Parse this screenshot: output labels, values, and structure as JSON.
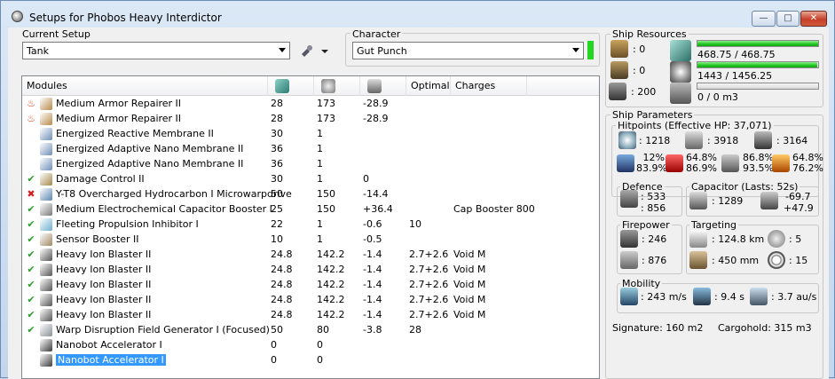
{
  "window": {
    "title": "Setups for Phobos Heavy Interdictor"
  },
  "current_setup": {
    "label": "Current Setup",
    "value": "Tank"
  },
  "character": {
    "label": "Character",
    "value": "Gut Punch"
  },
  "modules": {
    "columns": [
      "Modules",
      "Optimal",
      "Charges"
    ],
    "rows": [
      {
        "status": "overload",
        "name": "Medium Armor Repairer II",
        "cpu": "28",
        "pg": "173",
        "cap": "-28.9",
        "optimal": "",
        "charges": "",
        "icon": "armor-repairer-icon",
        "color": "#b88a4a"
      },
      {
        "status": "overload",
        "name": "Medium Armor Repairer II",
        "cpu": "28",
        "pg": "173",
        "cap": "-28.9",
        "optimal": "",
        "charges": "",
        "icon": "armor-repairer-icon",
        "color": "#b88a4a"
      },
      {
        "status": "passive",
        "name": "Energized Reactive Membrane II",
        "cpu": "30",
        "pg": "1",
        "cap": "",
        "optimal": "",
        "charges": "",
        "icon": "membrane-icon",
        "color": "#6f8fb8"
      },
      {
        "status": "passive",
        "name": "Energized Adaptive Nano Membrane II",
        "cpu": "36",
        "pg": "1",
        "cap": "",
        "optimal": "",
        "charges": "",
        "icon": "membrane-icon",
        "color": "#6f8fb8"
      },
      {
        "status": "passive",
        "name": "Energized Adaptive Nano Membrane II",
        "cpu": "36",
        "pg": "1",
        "cap": "",
        "optimal": "",
        "charges": "",
        "icon": "membrane-icon",
        "color": "#6f8fb8"
      },
      {
        "status": "active",
        "name": "Damage Control II",
        "cpu": "30",
        "pg": "1",
        "cap": "0",
        "optimal": "",
        "charges": "",
        "icon": "damage-control-icon",
        "color": "#a4884a"
      },
      {
        "status": "offline",
        "name": "Y-T8 Overcharged Hydrocarbon I Microwarpdrive",
        "cpu": "50",
        "pg": "150",
        "cap": "-14.4",
        "optimal": "",
        "charges": "",
        "icon": "microwarpdrive-icon",
        "color": "#5a86b0"
      },
      {
        "status": "active",
        "name": "Medium Electrochemical Capacitor Booster I",
        "cpu": "25",
        "pg": "150",
        "cap": "+36.4",
        "optimal": "",
        "charges": "Cap Booster 800",
        "icon": "capacitor-booster-icon",
        "color": "#7b7b7b"
      },
      {
        "status": "active",
        "name": "Fleeting Propulsion Inhibitor I",
        "cpu": "22",
        "pg": "1",
        "cap": "-0.6",
        "optimal": "10",
        "charges": "",
        "icon": "propulsion-inhibitor-icon",
        "color": "#6cb0d0"
      },
      {
        "status": "active",
        "name": "Sensor Booster II",
        "cpu": "10",
        "pg": "1",
        "cap": "-0.5",
        "optimal": "",
        "charges": "",
        "icon": "sensor-booster-icon",
        "color": "#a08862"
      },
      {
        "status": "active",
        "name": "Heavy Ion Blaster II",
        "cpu": "24.8",
        "pg": "142.2",
        "cap": "-1.4",
        "optimal": "2.7+2.6",
        "charges": "Void M",
        "icon": "blaster-icon",
        "color": "#555555"
      },
      {
        "status": "active",
        "name": "Heavy Ion Blaster II",
        "cpu": "24.8",
        "pg": "142.2",
        "cap": "-1.4",
        "optimal": "2.7+2.6",
        "charges": "Void M",
        "icon": "blaster-icon",
        "color": "#555555"
      },
      {
        "status": "active",
        "name": "Heavy Ion Blaster II",
        "cpu": "24.8",
        "pg": "142.2",
        "cap": "-1.4",
        "optimal": "2.7+2.6",
        "charges": "Void M",
        "icon": "blaster-icon",
        "color": "#555555"
      },
      {
        "status": "active",
        "name": "Heavy Ion Blaster II",
        "cpu": "24.8",
        "pg": "142.2",
        "cap": "-1.4",
        "optimal": "2.7+2.6",
        "charges": "Void M",
        "icon": "blaster-icon",
        "color": "#555555"
      },
      {
        "status": "active",
        "name": "Heavy Ion Blaster II",
        "cpu": "24.8",
        "pg": "142.2",
        "cap": "-1.4",
        "optimal": "2.7+2.6",
        "charges": "Void M",
        "icon": "blaster-icon",
        "color": "#555555"
      },
      {
        "status": "active",
        "name": "Warp Disruption Field Generator I (Focused)",
        "cpu": "50",
        "pg": "80",
        "cap": "-3.8",
        "optimal": "28",
        "charges": "",
        "icon": "warp-disruptor-icon",
        "color": "#8a8f96"
      },
      {
        "status": "none",
        "name": "Nanobot Accelerator I",
        "cpu": "0",
        "pg": "0",
        "cap": "",
        "optimal": "",
        "charges": "",
        "icon": "rig-icon",
        "color": "#3b3b3b"
      },
      {
        "status": "none",
        "name": "Nanobot Accelerator I",
        "cpu": "0",
        "pg": "0",
        "cap": "",
        "optimal": "",
        "charges": "",
        "icon": "rig-icon",
        "color": "#3b3b3b",
        "selected": true
      }
    ]
  },
  "resources": {
    "title": "Ship Resources",
    "turret": ": 0",
    "launcher": ": 0",
    "drones": ": 200",
    "cpu": {
      "text": "468.75 / 468.75",
      "fraction": 1.0
    },
    "powergrid": {
      "text": "1443 / 1456.25",
      "fraction": 0.991
    },
    "dronebay": {
      "text": "0 / 0 m3",
      "fraction": 0.0
    }
  },
  "parameters": {
    "title": "Ship Parameters",
    "hitpoints_label": "Hitpoints (Effective HP: 37,071)",
    "shield_hp": ": 1218",
    "armor_hp": ": 3918",
    "structure_hp": ": 3164",
    "shield_res": [
      "12%",
      "83.9%"
    ],
    "armor_res": [
      "64.8%",
      "86.9%"
    ],
    "hull_res": [
      "86.8%",
      "93.5%"
    ],
    "extra_res": [
      "64.8%",
      "76.2%"
    ],
    "defence": {
      "title": "Defence",
      "a": ": 533",
      "b": ": 856"
    },
    "capacitor": {
      "title": "Capacitor (Lasts: 52s)",
      "amount": ": 1289",
      "delta1": "-69.7",
      "delta2": "+47.9"
    },
    "firepower": {
      "title": "Firepower",
      "a": ": 246",
      "b": ": 876"
    },
    "targeting": {
      "title": "Targeting",
      "range": ": 124.8 km",
      "targets": ": 5",
      "res": ": 450 mm",
      "scan": ": 15"
    },
    "mobility": {
      "title": "Mobility",
      "speed": ": 243 m/s",
      "align": ": 9.4 s",
      "warp": ": 3.7 au/s"
    },
    "signature": "Signature: 160 m2",
    "cargohold": "Cargohold: 315 m3"
  }
}
